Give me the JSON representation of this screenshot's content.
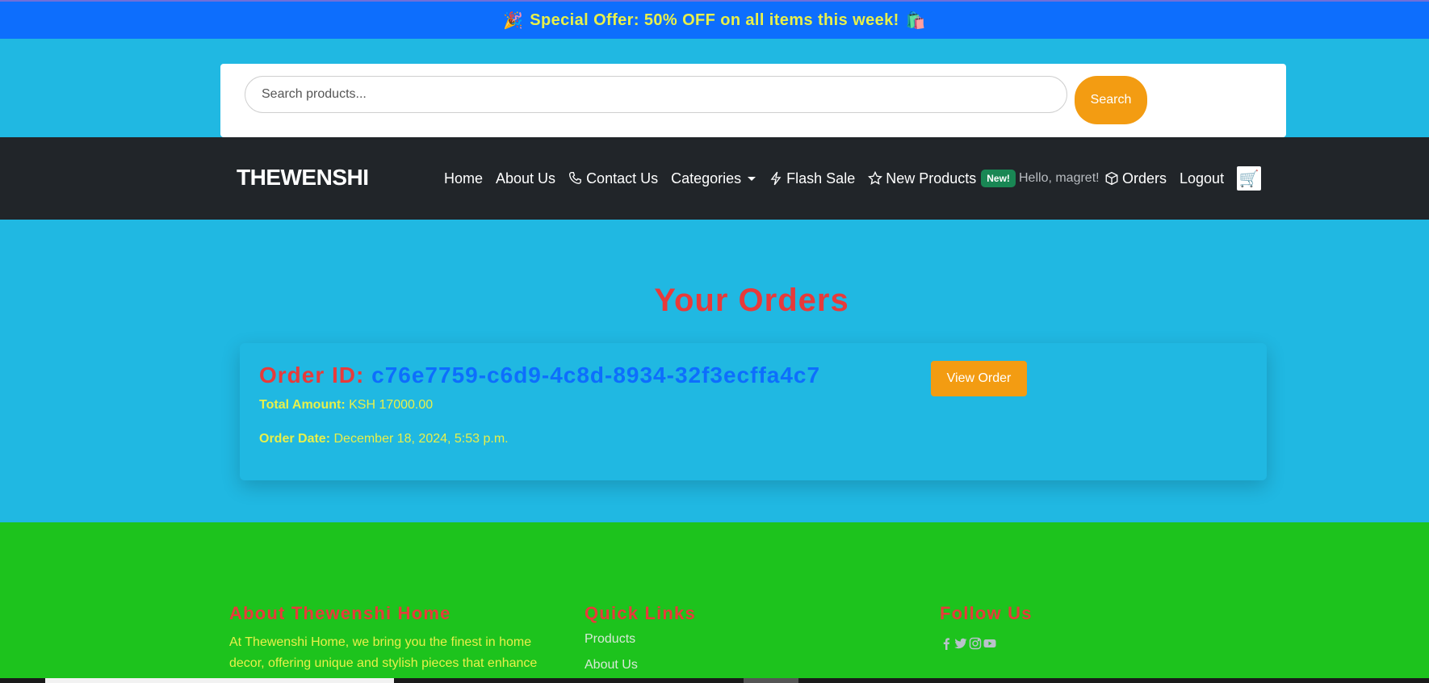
{
  "promo": {
    "text": "Special Offer: 50% OFF on all items this week!",
    "left_emoji": "🎉",
    "right_emoji": "🛍️"
  },
  "search": {
    "placeholder": "Search products...",
    "button": "Search"
  },
  "navbar": {
    "brand": "THEWENSHI",
    "items": {
      "home": "Home",
      "about": "About Us",
      "contact": "Contact Us",
      "categories": "Categories",
      "flash": "Flash Sale",
      "new_products": "New Products",
      "new_badge": "New!"
    },
    "greeting": "Hello, magret!",
    "orders": "Orders",
    "logout": "Logout",
    "cart_icon": "cart-icon"
  },
  "orders_page": {
    "title": "Your Orders",
    "orders": [
      {
        "id_label": "Order ID:",
        "id": "c76e7759-c6d9-4c8d-8934-32f3ecffa4c7",
        "total_label": "Total Amount:",
        "total": "KSH 17000.00",
        "date_label": "Order Date:",
        "date": "December 18, 2024, 5:53 p.m.",
        "view_button": "View Order"
      }
    ]
  },
  "footer": {
    "about": {
      "title": "About Thewenshi Home",
      "text": "At Thewenshi Home, we bring you the finest in home decor, offering unique and stylish pieces that enhance"
    },
    "quick_links": {
      "title": "Quick Links",
      "links": [
        "Products",
        "About Us"
      ]
    },
    "follow": {
      "title": "Follow Us",
      "icons": [
        "facebook-icon",
        "twitter-icon",
        "instagram-icon",
        "youtube-icon"
      ]
    }
  },
  "colors": {
    "page_bg": "#20b8e2",
    "promo_bg": "#0d6efd",
    "navbar_bg": "#212529",
    "accent_orange": "#f39c12",
    "heading_red": "#e83a3a",
    "text_yellow": "#e8f04a",
    "footer_bg": "#1dc31d",
    "badge_green": "#198754"
  }
}
